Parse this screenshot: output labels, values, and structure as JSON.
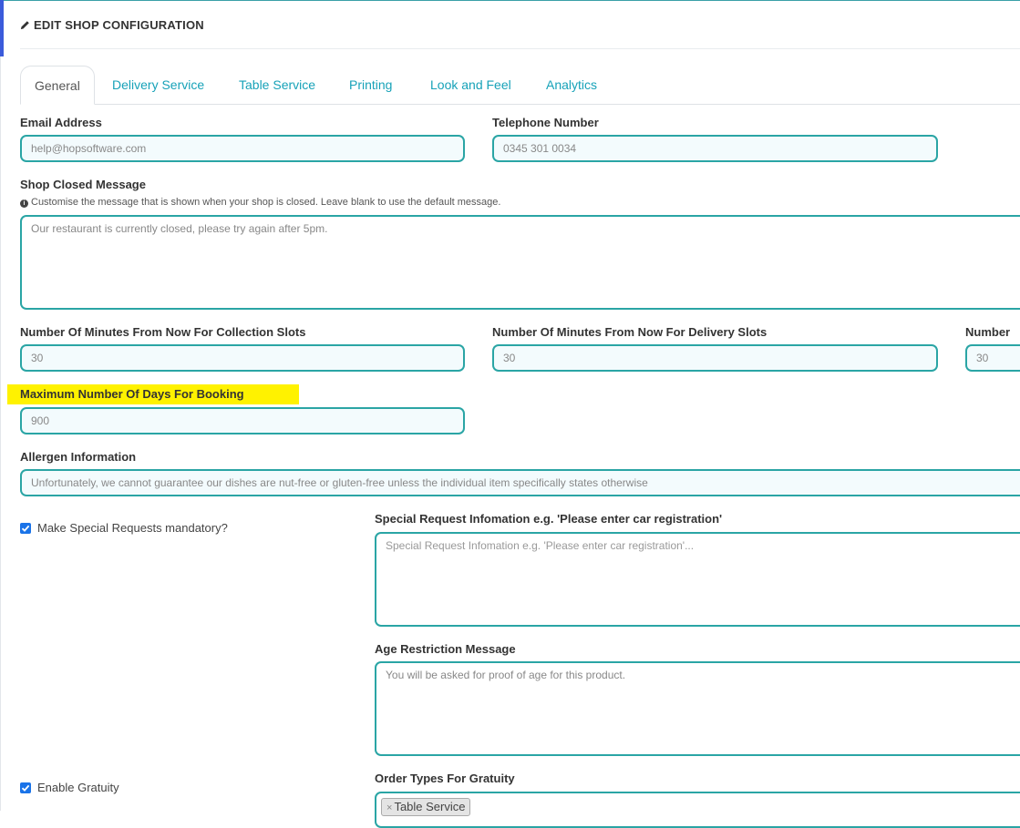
{
  "header": {
    "title": "EDIT SHOP CONFIGURATION",
    "icon": "pencil-icon"
  },
  "tabs": [
    {
      "label": "General",
      "active": true
    },
    {
      "label": "Delivery Service"
    },
    {
      "label": "Table Service"
    },
    {
      "label": "Printing"
    },
    {
      "label": "Look and Feel"
    },
    {
      "label": "Analytics"
    }
  ],
  "form": {
    "email": {
      "label": "Email Address",
      "value": "help@hopsoftware.com"
    },
    "telephone": {
      "label": "Telephone Number",
      "value": "0345 301 0034"
    },
    "closed_message": {
      "label": "Shop Closed Message",
      "help": "Customise the message that is shown when your shop is closed. Leave blank to use the default message.",
      "value": "Our restaurant is currently closed, please try again after 5pm."
    },
    "collection_minutes": {
      "label": "Number Of Minutes From Now For Collection Slots",
      "value": "30"
    },
    "delivery_minutes": {
      "label": "Number Of Minutes From Now For Delivery Slots",
      "value": "30"
    },
    "third_minutes": {
      "label": "Number",
      "value": "30"
    },
    "max_days": {
      "label": "Maximum Number Of Days For Booking",
      "value": "900"
    },
    "allergen": {
      "label": "Allergen Information",
      "value": "Unfortunately, we cannot guarantee our dishes are nut-free or gluten-free unless the individual item specifically states otherwise"
    },
    "special_mandatory": {
      "label": "Make Special Requests mandatory?",
      "checked": true
    },
    "special_info": {
      "label": "Special Request Infomation e.g. 'Please enter car registration'",
      "placeholder": "Special Request Infomation e.g. 'Please enter car registration'..."
    },
    "age_restriction": {
      "label": "Age Restriction Message",
      "value": "You will be asked for proof of age for this product."
    },
    "gratuity": {
      "label": "Enable Gratuity",
      "checked": true
    },
    "gratuity_types": {
      "label": "Order Types For Gratuity",
      "tags": [
        "Table Service"
      ]
    }
  },
  "colors": {
    "accent": "#17a2b8",
    "field_border": "#2aa5a5",
    "highlight": "#fff200",
    "checkbox": "#1a73e8"
  }
}
